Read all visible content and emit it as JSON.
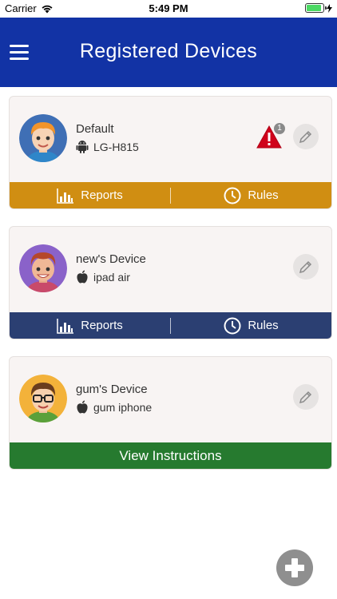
{
  "status_bar": {
    "carrier": "Carrier",
    "time": "5:49 PM"
  },
  "nav": {
    "title": "Registered Devices"
  },
  "devices": [
    {
      "name": "Default",
      "model": "LG-H815",
      "os": "android-icon",
      "alert_count": "1",
      "footer": {
        "reports": "Reports",
        "rules": "Rules"
      },
      "footer_color": "#d08e12"
    },
    {
      "name": "new's Device",
      "model": "ipad air",
      "os": "apple-icon",
      "footer": {
        "reports": "Reports",
        "rules": "Rules"
      },
      "footer_color": "#2b3f72"
    },
    {
      "name": "gum's Device",
      "model": "gum iphone",
      "os": "apple-icon",
      "footer": {
        "instructions": "View Instructions"
      },
      "footer_color": "#267a2f"
    }
  ],
  "colors": {
    "nav": "#1233a5",
    "accent_orange": "#d08e12",
    "accent_blue": "#2b3f72",
    "accent_green": "#267a2f"
  }
}
